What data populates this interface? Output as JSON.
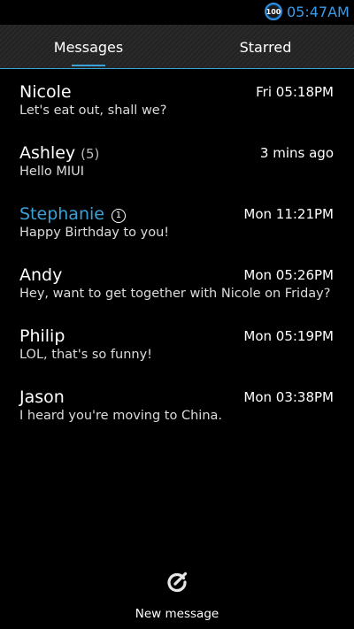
{
  "status_bar": {
    "battery_level": "100",
    "time": "05:47AM"
  },
  "tabs": [
    {
      "label": "Messages",
      "active": true
    },
    {
      "label": "Starred",
      "active": false
    }
  ],
  "conversations": [
    {
      "name": "Nicole",
      "count": "",
      "badge": "",
      "time": "Fri 05:18PM",
      "preview": "Let's eat out, shall we?"
    },
    {
      "name": "Ashley",
      "count": "(5)",
      "badge": "",
      "time": "3 mins ago",
      "preview": "Hello MIUI"
    },
    {
      "name": "Stephanie",
      "count": "",
      "badge": "1",
      "time": "Mon 11:21PM",
      "preview": "Happy Birthday to you!"
    },
    {
      "name": "Andy",
      "count": "",
      "badge": "",
      "time": "Mon 05:26PM",
      "preview": "Hey, want to get together with Nicole on Friday?"
    },
    {
      "name": "Philip",
      "count": "",
      "badge": "",
      "time": "Mon 05:19PM",
      "preview": "LOL, that's so funny!"
    },
    {
      "name": "Jason",
      "count": "",
      "badge": "",
      "time": "Mon 03:38PM",
      "preview": "I heard you're moving to China."
    }
  ],
  "bottom": {
    "new_message_label": "New message",
    "icon": "compose-icon"
  },
  "colors": {
    "accent": "#3aa0d8",
    "background": "#000000"
  }
}
